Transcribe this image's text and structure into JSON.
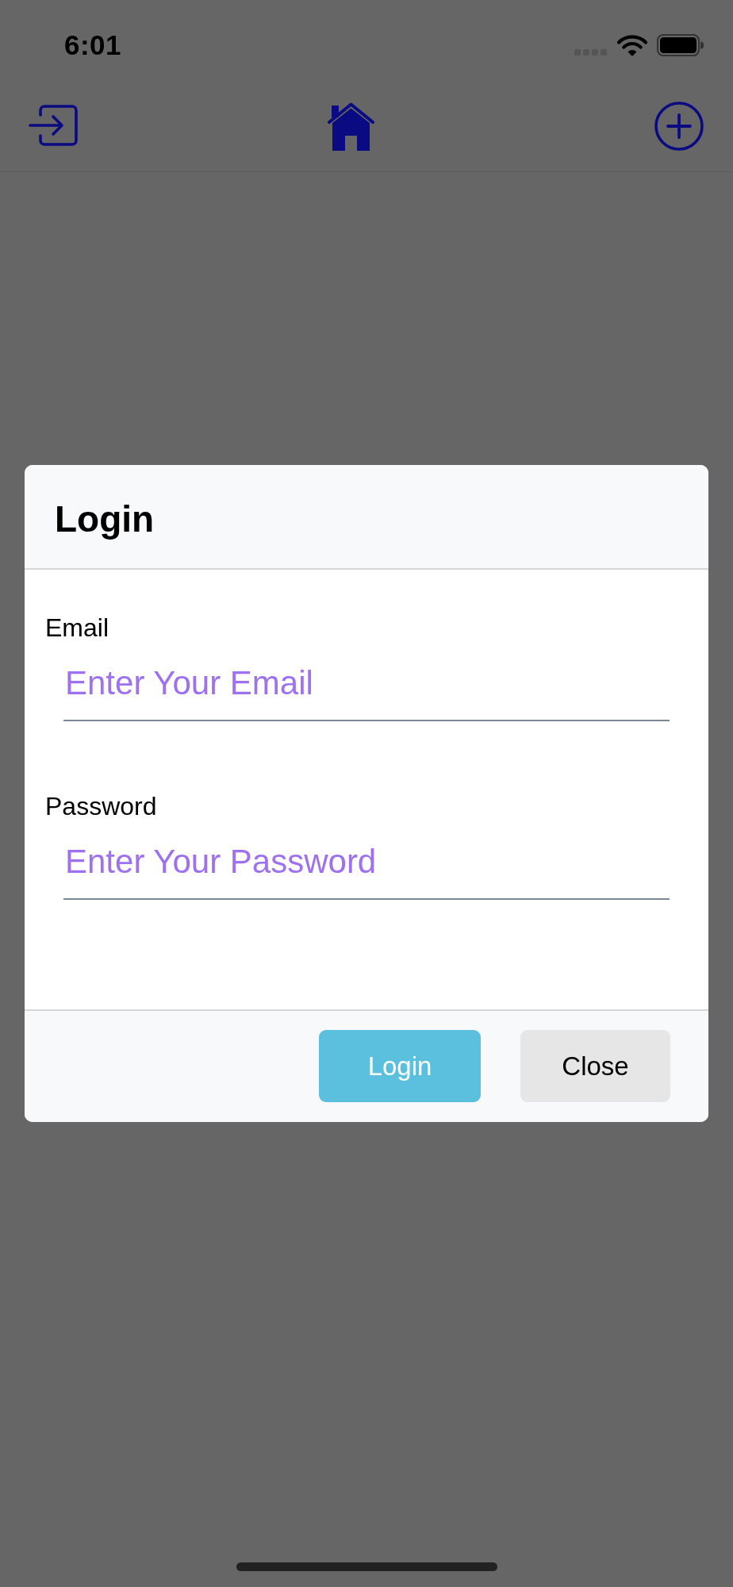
{
  "status_bar": {
    "time": "6:01"
  },
  "modal": {
    "title": "Login",
    "fields": [
      {
        "label": "Email",
        "placeholder": "Enter Your Email"
      },
      {
        "label": "Password",
        "placeholder": "Enter Your Password"
      }
    ],
    "buttons": [
      {
        "label": "Login",
        "kind": "primary"
      },
      {
        "label": "Close",
        "kind": "secondary"
      }
    ]
  }
}
